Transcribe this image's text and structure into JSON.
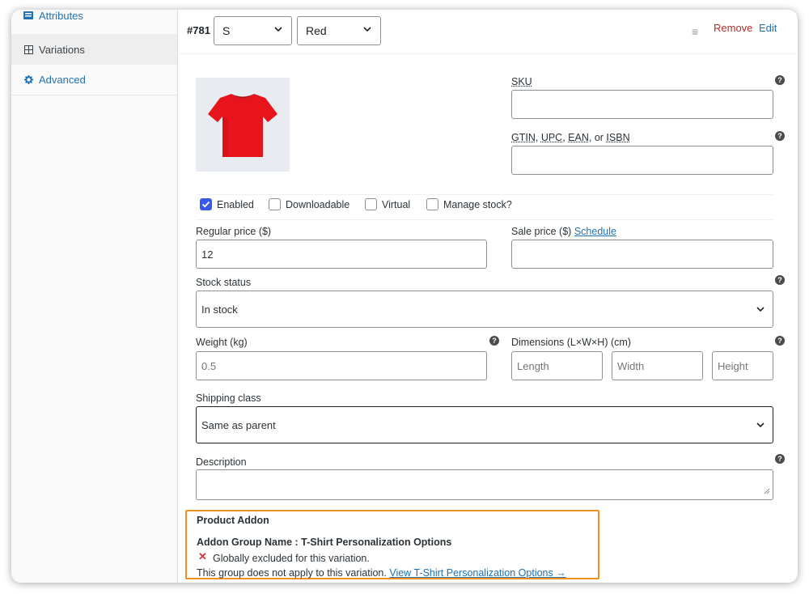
{
  "sidebar": {
    "items": [
      {
        "label": "Attributes",
        "icon": "list-icon"
      },
      {
        "label": "Variations",
        "icon": "grid-icon"
      },
      {
        "label": "Advanced",
        "icon": "gear-icon"
      }
    ]
  },
  "variation": {
    "id": "#781",
    "size_value": "S",
    "color_value": "Red",
    "remove_label": "Remove",
    "edit_label": "Edit"
  },
  "fields": {
    "sku_label": "SKU",
    "gtin_label_parts": [
      "GTIN",
      "UPC",
      "EAN",
      "ISBN"
    ],
    "gtin_sep": ", ",
    "gtin_or": ", or ",
    "enabled_label": "Enabled",
    "downloadable_label": "Downloadable",
    "virtual_label": "Virtual",
    "manage_stock_label": "Manage stock?",
    "regular_price_label": "Regular price ($)",
    "regular_price_value": "12",
    "sale_price_label": "Sale price ($)",
    "schedule_label": "Schedule",
    "stock_status_label": "Stock status",
    "stock_status_value": "In stock",
    "weight_label": "Weight (kg)",
    "weight_placeholder": "0.5",
    "dimensions_label": "Dimensions (L×W×H) (cm)",
    "length_placeholder": "Length",
    "width_placeholder": "Width",
    "height_placeholder": "Height",
    "shipping_class_label": "Shipping class",
    "shipping_class_value": "Same as parent",
    "description_label": "Description"
  },
  "checkboxes": {
    "enabled": true,
    "downloadable": false,
    "virtual": false,
    "manage_stock": false
  },
  "addon": {
    "title": "Product Addon",
    "group_name": "Addon Group Name : T-Shirt Personalization Options",
    "excluded_text": "Globally excluded for this variation.",
    "not_apply_text": "This group does not apply to this variation.",
    "view_link": "View T-Shirt Personalization Options →"
  },
  "colors": {
    "accent": "#2271b1",
    "remove": "#b32d2e",
    "highlight_border": "#f0921e",
    "checkbox": "#3858e9",
    "shirt": "#e8141b"
  }
}
